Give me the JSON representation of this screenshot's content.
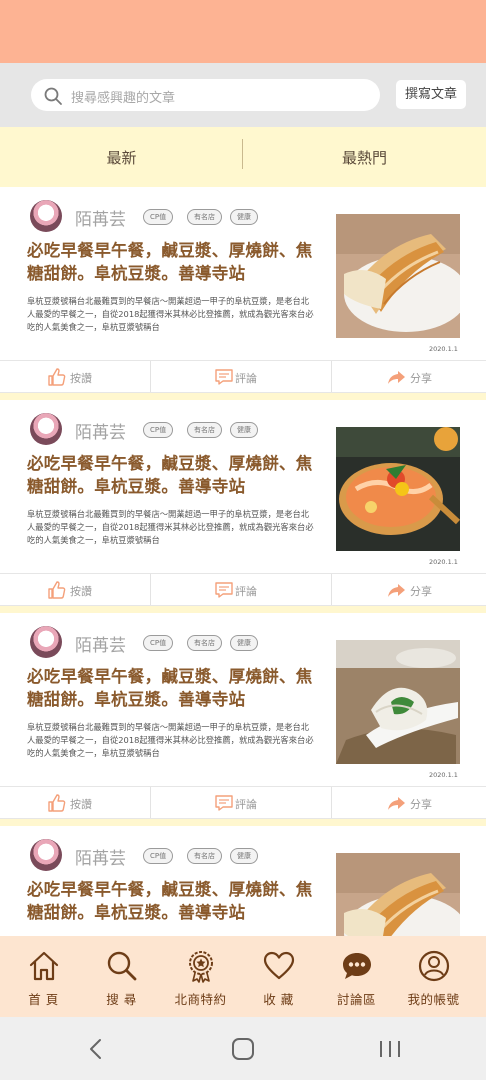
{
  "search": {
    "placeholder": "搜尋感興趣的文章",
    "write_label": "撰寫文章"
  },
  "tabs": [
    {
      "label": "最新"
    },
    {
      "label": "最熱門"
    }
  ],
  "posts": [
    {
      "author": "陌苒芸",
      "tags": [
        "CP值",
        "有名店",
        "健康"
      ],
      "title": "必吃早餐早午餐，鹹豆漿、厚燒餅、焦糖甜餅。阜杭豆漿。善導寺站",
      "excerpt": "阜杭豆漿號稱台北最難買到的早餐店～開業超過一甲子的阜杭豆漿，是老台北人最愛的早餐之一，自從2018起獲得米其林必比登推薦，就成為觀光客來台必吃的人氣美食之一，阜杭豆漿號稱台",
      "date": "2020.1.1",
      "image": "youtiao-shaobing"
    },
    {
      "author": "陌苒芸",
      "tags": [
        "CP值",
        "有名店",
        "健康"
      ],
      "title": "必吃早餐早午餐，鹹豆漿、厚燒餅、焦糖甜餅。阜杭豆漿。善導寺站",
      "excerpt": "阜杭豆漿號稱台北最難買到的早餐店～開業超過一甲子的阜杭豆漿，是老台北人最愛的早餐之一，自從2018起獲得米其林必比登推薦，就成為觀光客來台必吃的人氣美食之一，阜杭豆漿號稱台",
      "date": "2020.1.1",
      "image": "seafood-platter"
    },
    {
      "author": "陌苒芸",
      "tags": [
        "CP值",
        "有名店",
        "健康"
      ],
      "title": "必吃早餐早午餐，鹹豆漿、厚燒餅、焦糖甜餅。阜杭豆漿。善導寺站",
      "excerpt": "阜杭豆漿號稱台北最難買到的早餐店～開業超過一甲子的阜杭豆漿，是老台北人最愛的早餐之一，自從2018起獲得米其林必比登推薦，就成為觀光客來台必吃的人氣美食之一，阜杭豆漿號稱台",
      "date": "2020.1.1",
      "image": "dumplings"
    },
    {
      "author": "陌苒芸",
      "tags": [
        "CP值",
        "有名店",
        "健康"
      ],
      "title": "必吃早餐早午餐，鹹豆漿、厚燒餅、焦糖甜餅。阜杭豆漿。善導寺站",
      "image": "youtiao-shaobing"
    }
  ],
  "actions": {
    "like": "按讚",
    "comment": "評論",
    "share": "分享"
  },
  "bottom_nav": [
    {
      "label": "首 頁",
      "icon": "home-icon"
    },
    {
      "label": "搜 尋",
      "icon": "search-icon"
    },
    {
      "label": "北商特約",
      "icon": "badge-icon"
    },
    {
      "label": "收 藏",
      "icon": "heart-icon"
    },
    {
      "label": "討論區",
      "icon": "chat-icon"
    },
    {
      "label": "我的帳號",
      "icon": "user-icon"
    }
  ],
  "colors": {
    "header": "#fdb393",
    "tabs_bg": "#fff8cf",
    "title": "#8a5a2d",
    "nav_bg": "#fde5d0",
    "accent": "#f4a07a"
  }
}
